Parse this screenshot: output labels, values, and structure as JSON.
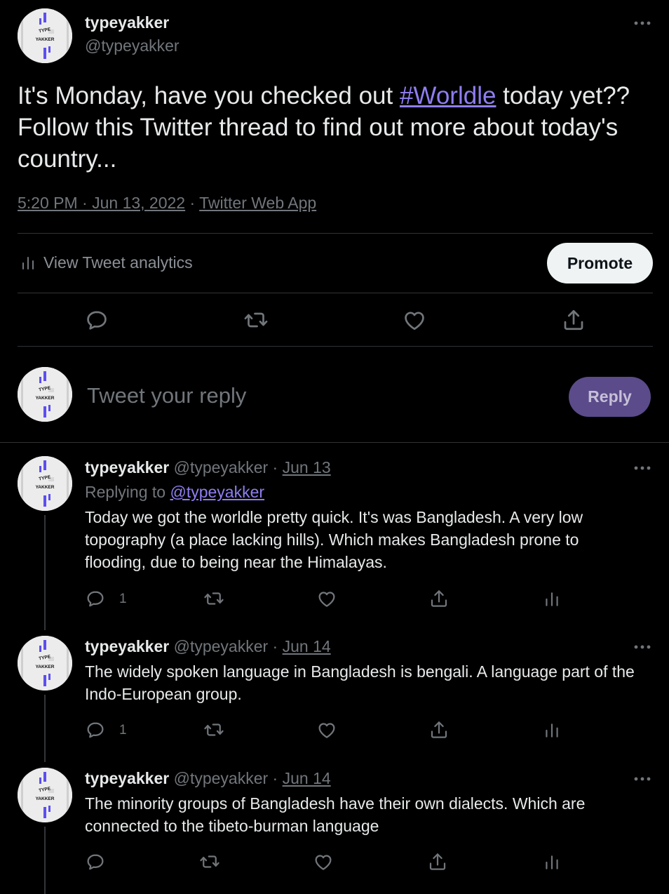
{
  "main_tweet": {
    "display_name": "typeyakker",
    "handle": "@typeyakker",
    "text_before": "It's Monday, have you checked out ",
    "hashtag": "#Worldle",
    "text_after": " today yet??  Follow this Twitter thread to find out more about today's country...",
    "time": "5:20 PM · Jun 13, 2022",
    "separator": " · ",
    "source": "Twitter Web App",
    "analytics_label": "View Tweet analytics",
    "promote_label": "Promote"
  },
  "avatar": {
    "line1": "TYPE",
    "line2": "YAKKER"
  },
  "composer": {
    "placeholder": "Tweet your reply",
    "reply_label": "Reply"
  },
  "replies": [
    {
      "display_name": "typeyakker",
      "handle": "@typeyakker",
      "dot": " · ",
      "date": "Jun 13",
      "replying_prefix": "Replying to ",
      "replying_to": "@typeyakker",
      "text": "Today we got the worldle pretty quick. It's was Bangladesh. A very low topography (a place lacking hills). Which makes Bangladesh prone to flooding, due to being near the Himalayas.",
      "reply_count": "1"
    },
    {
      "display_name": "typeyakker",
      "handle": "@typeyakker",
      "dot": " · ",
      "date": "Jun 14",
      "text": "The widely spoken language in Bangladesh is bengali. A language part of the Indo-European group.",
      "reply_count": "1"
    },
    {
      "display_name": "typeyakker",
      "handle": "@typeyakker",
      "dot": " · ",
      "date": "Jun 14",
      "text": "The minority groups of Bangladesh have their own dialects. Which are connected to the tibeto-burman language"
    }
  ],
  "colors": {
    "background": "#000000",
    "text": "#e7e9ea",
    "muted": "#71767b",
    "link": "#8e7ef0",
    "reply_button": "#5b4b8a",
    "promote_button": "#eff3f4"
  },
  "icons": [
    "more-icon",
    "analytics-icon",
    "reply-icon",
    "retweet-icon",
    "like-icon",
    "share-icon"
  ]
}
